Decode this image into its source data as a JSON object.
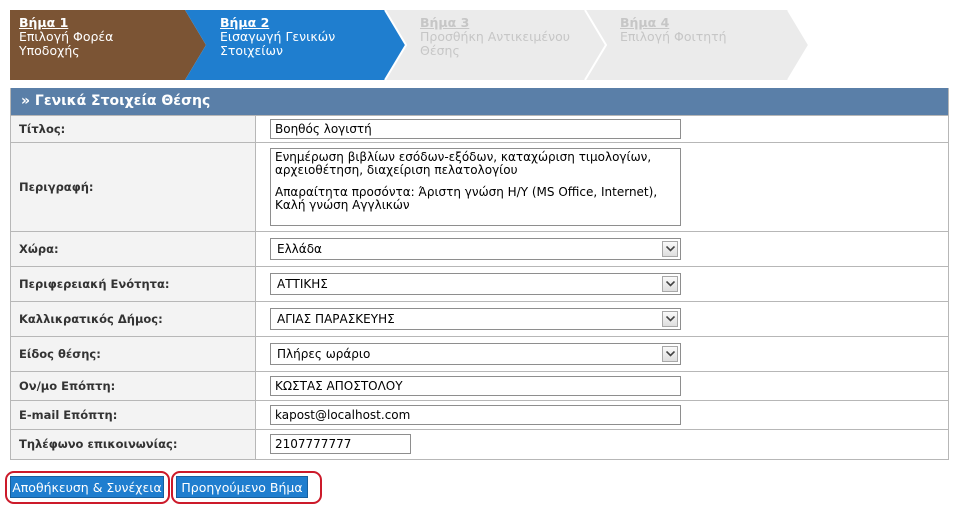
{
  "steps": [
    {
      "title": "Βήμα 1",
      "desc": "Επιλογή Φορέα Υποδοχής",
      "state": "completed"
    },
    {
      "title": "Βήμα 2",
      "desc": "Εισαγωγή Γενικών Στοιχείων",
      "state": "active"
    },
    {
      "title": "Βήμα 3",
      "desc": "Προσθήκη Αντικειμένου Θέσης",
      "state": "disabled"
    },
    {
      "title": "Βήμα 4",
      "desc": "Επιλογή Φοιτητή",
      "state": "disabled"
    }
  ],
  "colors": {
    "step_completed": "#7b5434",
    "step_active": "#1f7ecf",
    "step_disabled": "#ebebeb",
    "panel_header": "#5a7fa8",
    "button": "#1f7ecf",
    "highlight_ring": "#cc1a2a"
  },
  "form": {
    "header": "» Γενικά Στοιχεία Θέσης",
    "title": {
      "label": "Τίτλος:",
      "value": "Βοηθός λογιστή"
    },
    "description": {
      "label": "Περιγραφή:",
      "paragraph1": "Ενημέρωση βιβλίων εσόδων-εξόδων, καταχώριση τιμολογίων, αρχειοθέτηση, διαχείριση πελατολογίου",
      "paragraph2": "Απαραίτητα προσόντα: Άριστη γνώση Η/Υ (MS Office, Internet), Καλή γνώση Αγγλικών"
    },
    "country": {
      "label": "Χώρα:",
      "value": "Ελλάδα"
    },
    "regional_unit": {
      "label": "Περιφερειακή Ενότητα:",
      "value": "ΑΤΤΙΚΗΣ"
    },
    "municipality": {
      "label": "Καλλικρατικός Δήμος:",
      "value": "ΑΓΙΑΣ ΠΑΡΑΣΚΕΥΗΣ"
    },
    "position_type": {
      "label": "Είδος θέσης:",
      "value": "Πλήρες ωράριο"
    },
    "supervisor_name": {
      "label": "Ον/μο Επόπτη:",
      "value": "ΚΩΣΤΑΣ ΑΠΟΣΤΟΛΟΥ"
    },
    "supervisor_email": {
      "label": "E-mail Επόπτη:",
      "value": "kapost@localhost.com"
    },
    "phone": {
      "label": "Τηλέφωνο επικοινωνίας:",
      "value": "2107777777"
    }
  },
  "buttons": {
    "save_continue": "Αποθήκευση & Συνέχεια",
    "previous_step": "Προηγούμενο Βήμα"
  },
  "icons": {
    "dropdown": "chevron-down-icon"
  }
}
